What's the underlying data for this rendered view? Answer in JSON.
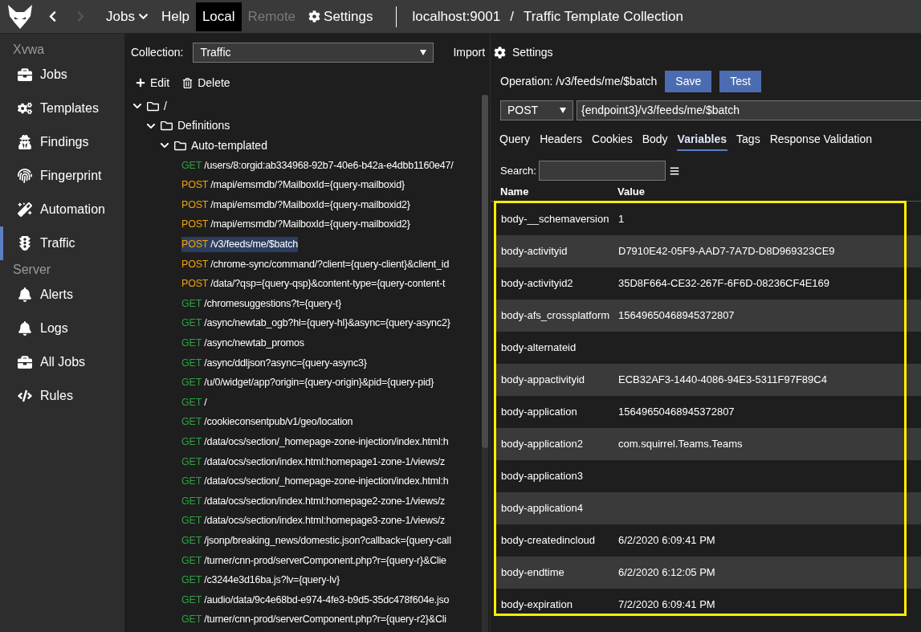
{
  "topbar": {
    "nav": [
      {
        "disabled": false
      },
      {
        "disabled": true
      }
    ],
    "menu": [
      {
        "label": "Jobs",
        "kind": "dropdown",
        "selected": false,
        "disabled": false
      },
      {
        "label": "Help",
        "kind": "link",
        "selected": false,
        "disabled": false
      },
      {
        "label": "Local",
        "kind": "link",
        "selected": true,
        "disabled": false
      },
      {
        "label": "Remote",
        "kind": "link",
        "selected": false,
        "disabled": true
      },
      {
        "label": "Settings",
        "kind": "settings",
        "selected": false,
        "disabled": false
      }
    ],
    "host": "localhost:9001",
    "separator": "/",
    "title": "Traffic Template Collection"
  },
  "sidebar": {
    "sections": [
      {
        "title": "Xvwa",
        "items": [
          {
            "label": "Jobs",
            "selected": false
          },
          {
            "label": "Templates",
            "selected": false
          },
          {
            "label": "Findings",
            "selected": false
          },
          {
            "label": "Fingerprint",
            "selected": false
          },
          {
            "label": "Automation",
            "selected": false
          },
          {
            "label": "Traffic",
            "selected": true
          }
        ]
      },
      {
        "title": "Server",
        "items": [
          {
            "label": "Alerts",
            "selected": false
          },
          {
            "label": "Logs",
            "selected": false
          },
          {
            "label": "All Jobs",
            "selected": false
          },
          {
            "label": "Rules",
            "selected": false
          }
        ]
      }
    ]
  },
  "collection": {
    "label": "Collection:",
    "value": "Traffic",
    "import": "Import",
    "settings": "Settings"
  },
  "tree_actions": [
    "Edit",
    "Delete"
  ],
  "tree": [
    {
      "name": "/",
      "expanded": true,
      "children": [
        {
          "name": "Definitions",
          "expanded": true,
          "children": [
            {
              "name": "Auto-templated",
              "expanded": true,
              "children": [
                {
                  "method": "GET",
                  "color": "#2ea043",
                  "path": "/users/8:orgid:ab334968-92b7-40e6-b42a-e4dbb1160e47/",
                  "selected": false
                },
                {
                  "method": "POST",
                  "color": "#f0a30a",
                  "path": "/mapi/emsmdb/?MailboxId={query-mailboxid}",
                  "selected": false
                },
                {
                  "method": "POST",
                  "color": "#f0a30a",
                  "path": "/mapi/emsmdb/?MailboxId={query-mailboxid2}",
                  "selected": false
                },
                {
                  "method": "POST",
                  "color": "#f0a30a",
                  "path": "/mapi/emsmdb/?MailboxId={query-mailboxid2}",
                  "selected": false
                },
                {
                  "method": "POST",
                  "color": "#f0a30a",
                  "path": "/v3/feeds/me/$batch",
                  "selected": true
                },
                {
                  "method": "POST",
                  "color": "#f0a30a",
                  "path": "/chrome-sync/command/?client={query-client}&client_id",
                  "selected": false
                },
                {
                  "method": "POST",
                  "color": "#f0a30a",
                  "path": "/data/?qsp={query-qsp}&content-type={query-content-t",
                  "selected": false
                },
                {
                  "method": "GET",
                  "color": "#2ea043",
                  "path": "/chromesuggestions?t={query-t}",
                  "selected": false
                },
                {
                  "method": "GET",
                  "color": "#2ea043",
                  "path": "/async/newtab_ogb?hl={query-hl}&async={query-async2}",
                  "selected": false
                },
                {
                  "method": "GET",
                  "color": "#2ea043",
                  "path": "/async/newtab_promos",
                  "selected": false
                },
                {
                  "method": "GET",
                  "color": "#2ea043",
                  "path": "/async/ddljson?async={query-async3}",
                  "selected": false
                },
                {
                  "method": "GET",
                  "color": "#2ea043",
                  "path": "/u/0/widget/app?origin={query-origin}&pid={query-pid}",
                  "selected": false
                },
                {
                  "method": "GET",
                  "color": "#2ea043",
                  "path": "/",
                  "selected": false
                },
                {
                  "method": "GET",
                  "color": "#2ea043",
                  "path": "/cookieconsentpub/v1/geo/location",
                  "selected": false
                },
                {
                  "method": "GET",
                  "color": "#2ea043",
                  "path": "/data/ocs/section/_homepage-zone-injection/index.html:h",
                  "selected": false
                },
                {
                  "method": "GET",
                  "color": "#2ea043",
                  "path": "/data/ocs/section/index.html:homepage1-zone-1/views/z",
                  "selected": false
                },
                {
                  "method": "GET",
                  "color": "#2ea043",
                  "path": "/data/ocs/section/_homepage-zone-injection/index.html:h",
                  "selected": false
                },
                {
                  "method": "GET",
                  "color": "#2ea043",
                  "path": "/data/ocs/section/index.html:homepage2-zone-1/views/z",
                  "selected": false
                },
                {
                  "method": "GET",
                  "color": "#2ea043",
                  "path": "/data/ocs/section/index.html:homepage3-zone-1/views/z",
                  "selected": false
                },
                {
                  "method": "GET",
                  "color": "#2ea043",
                  "path": "/jsonp/breaking_news/domestic.json?callback={query-call",
                  "selected": false
                },
                {
                  "method": "GET",
                  "color": "#2ea043",
                  "path": "/turner/cnn-prod/serverComponent.php?r={query-r}&Clie",
                  "selected": false
                },
                {
                  "method": "GET",
                  "color": "#2ea043",
                  "path": "/c3244e3d16ba.js?lv={query-lv}",
                  "selected": false
                },
                {
                  "method": "GET",
                  "color": "#2ea043",
                  "path": "/audio/data/9c4e68bd-e974-4fe3-b9d5-35dc478f604e.jso",
                  "selected": false
                },
                {
                  "method": "GET",
                  "color": "#2ea043",
                  "path": "/turner/cnn-prod/serverComponent.php?r={query-r2}&Cli",
                  "selected": false
                }
              ]
            }
          ]
        }
      ]
    }
  ],
  "operation": {
    "label": "Operation: /v3/feeds/me/$batch",
    "buttons": [
      "Save",
      "Test"
    ],
    "method": "POST",
    "url": "{endpoint3}/v3/feeds/me/$batch"
  },
  "tabs": [
    {
      "label": "Query",
      "selected": false
    },
    {
      "label": "Headers",
      "selected": false
    },
    {
      "label": "Cookies",
      "selected": false
    },
    {
      "label": "Body",
      "selected": false
    },
    {
      "label": "Variables",
      "selected": true
    },
    {
      "label": "Tags",
      "selected": false
    },
    {
      "label": "Response Validation",
      "selected": false
    }
  ],
  "search": {
    "label": "Search:"
  },
  "table": {
    "highlighted": true,
    "columns": [
      "Name",
      "Value"
    ],
    "rows": [
      [
        "body-__schemaversion",
        "1"
      ],
      [
        "body-activityid",
        "D7910E42-05F9-AAD7-7A7D-D8D969323CE9"
      ],
      [
        "body-activityid2",
        "35D8F664-CE32-267F-6F6D-08236CF4E169"
      ],
      [
        "body-afs_crossplatform",
        "15649650468945372807"
      ],
      [
        "body-alternateid",
        ""
      ],
      [
        "body-appactivityid",
        "ECB32AF3-1440-4086-94E3-5311F97F89C4"
      ],
      [
        "body-application",
        "15649650468945372807"
      ],
      [
        "body-application2",
        "com.squirrel.Teams.Teams"
      ],
      [
        "body-application3",
        ""
      ],
      [
        "body-application4",
        ""
      ],
      [
        "body-createdincloud",
        "6/2/2020 6:09:41 PM"
      ],
      [
        "body-endtime",
        "6/2/2020 6:12:05 PM"
      ],
      [
        "body-expiration",
        "7/2/2020 6:09:41 PM"
      ]
    ]
  }
}
